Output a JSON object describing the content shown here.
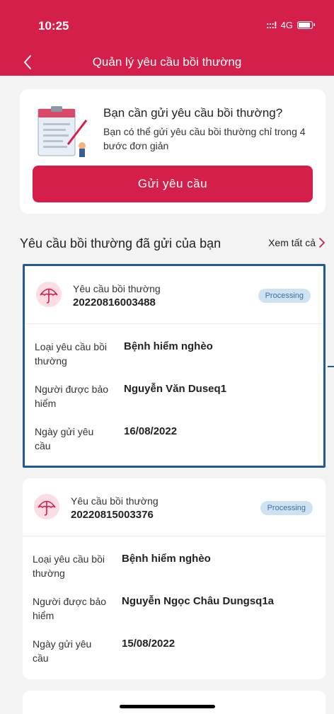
{
  "status_bar": {
    "time": "10:25",
    "signal": ":::!",
    "network": "4G"
  },
  "nav": {
    "title": "Quản lý yêu cầu bồi thường"
  },
  "intro": {
    "title": "Bạn cần gửi yêu cầu bồi thường?",
    "description": "Bạn có thể gửi yêu cầu bồi thường chỉ trong 4 bước đơn giản",
    "button_label": "Gửi yêu cầu"
  },
  "section": {
    "title": "Yêu cầu bồi thường đã gửi của bạn",
    "see_all": "Xem tất cả"
  },
  "claims": [
    {
      "label": "Yêu cầu bồi thường",
      "id": "20220816003488",
      "status": "Processing",
      "fields": [
        {
          "key": "Loại yêu cầu bồi thường",
          "value": "Bệnh hiểm nghèo"
        },
        {
          "key": "Người được bảo hiểm",
          "value": "Nguyễn Văn Duseq1"
        },
        {
          "key": "Ngày gửi yêu cầu",
          "value": "16/08/2022"
        }
      ]
    },
    {
      "label": "Yêu cầu bồi thường",
      "id": "20220815003376",
      "status": "Processing",
      "fields": [
        {
          "key": "Loại yêu cầu bồi thường",
          "value": "Bệnh hiểm nghèo"
        },
        {
          "key": "Người được bảo hiểm",
          "value": "Nguyễn Ngọc Châu Dungsq1a"
        },
        {
          "key": "Ngày gửi yêu cầu",
          "value": "15/08/2022"
        }
      ]
    }
  ],
  "colors": {
    "brand": "#d41f4a",
    "badge_bg": "#cfe2f2",
    "badge_text": "#3f6f9e",
    "selection": "#1f5b94"
  }
}
